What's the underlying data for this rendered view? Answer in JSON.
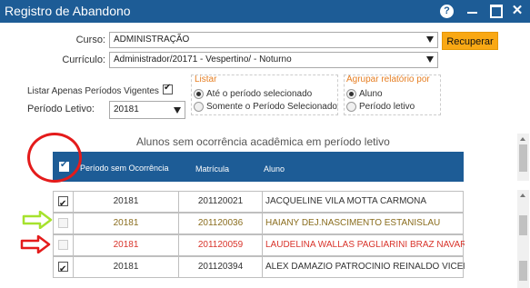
{
  "window": {
    "title": "Registro de Abandono",
    "help_label": "?",
    "close_label": "✕"
  },
  "form": {
    "curso_label": "Curso:",
    "curso_value": "ADMINISTRAÇÃO",
    "curriculo_label": "Currículo:",
    "curriculo_value": "Administrador/20171 - Vespertino/ - Noturno",
    "recuperar_label": "Recuperar",
    "listar_vigentes_label": "Listar Apenas Períodos Vigentes",
    "periodo_label": "Período Letivo:",
    "periodo_value": "20181",
    "listar_group": {
      "title": "Listar",
      "options": [
        "Até o período selecionado",
        "Somente o Período Selecionado"
      ]
    },
    "agrupar_group": {
      "title": "Agrupar relatório por",
      "options": [
        "Aluno",
        "Período letivo"
      ]
    }
  },
  "table": {
    "title": "Alunos sem ocorrência acadêmica em período letivo",
    "headers": [
      "Período sem Ocorrência",
      "Matrícula",
      "Aluno"
    ],
    "rows": [
      {
        "checked": true,
        "periodo": "20181",
        "matricula": "201120021",
        "aluno": "JACQUELINE VILA MOTTA CARMONA",
        "style": "normal"
      },
      {
        "checked": false,
        "periodo": "20181",
        "matricula": "201120036",
        "aluno": "HAIANY DEJ.NASCIMENTO ESTANISLAU",
        "style": "olive"
      },
      {
        "checked": false,
        "periodo": "20181",
        "matricula": "201120059",
        "aluno": "LAUDELINA WALLAS PAGLIARINI BRAZ NAVARRC",
        "style": "red"
      },
      {
        "checked": true,
        "periodo": "20181",
        "matricula": "201120394",
        "aluno": "ALEX DAMAZIO PATROCINIO REINALDO VICENTE",
        "style": "normal"
      }
    ]
  },
  "colors": {
    "header_blue": "#1d5c96",
    "button_orange": "#f9a814",
    "annotation_red": "#e41b1b",
    "annotation_green": "#a6e22e"
  }
}
